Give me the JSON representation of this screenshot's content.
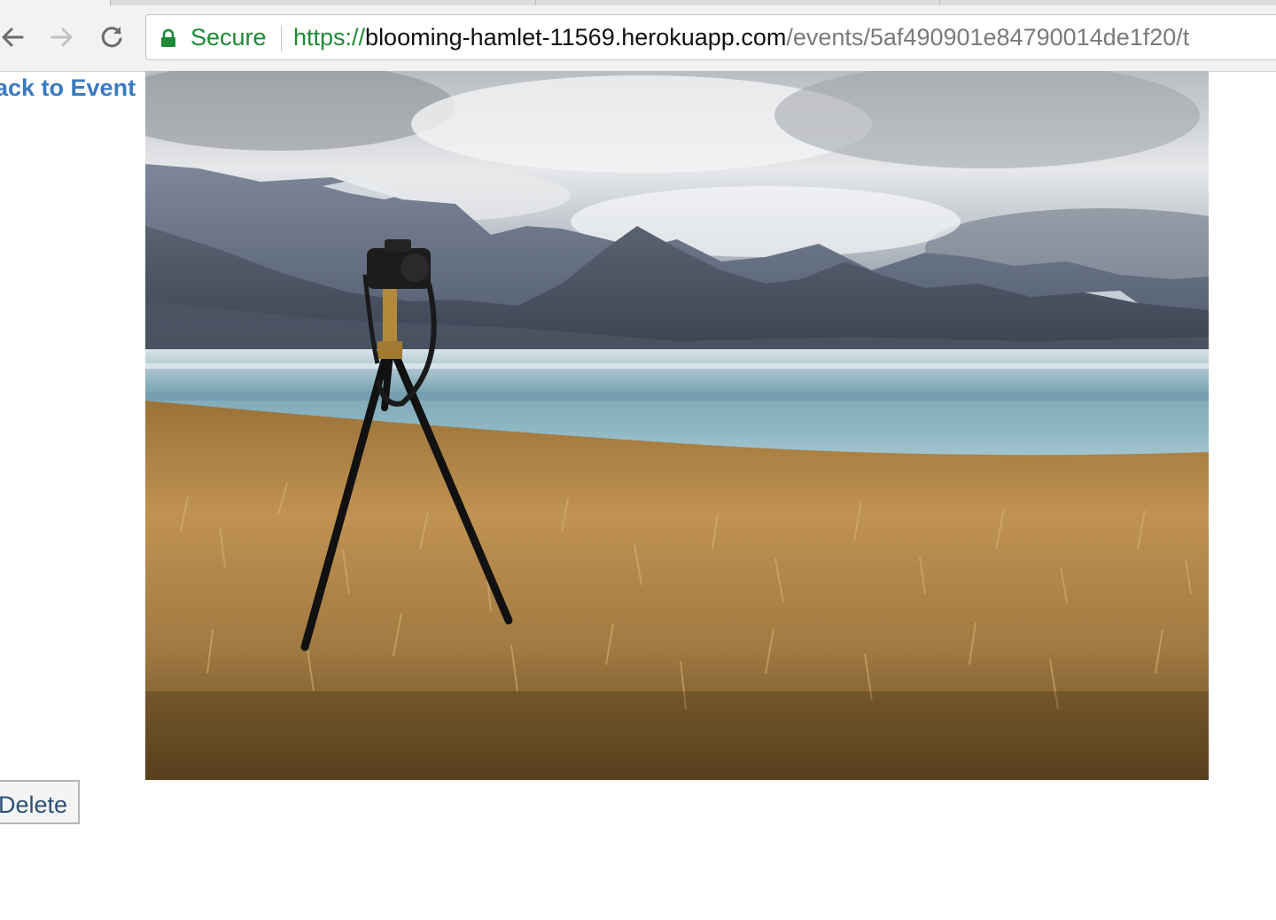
{
  "browser": {
    "secure_label": "Secure",
    "url_scheme": "https://",
    "url_host": "blooming-hamlet-11569.herokuapp.com",
    "url_path": "/events/5af490901e84790014de1f20/t",
    "icons": {
      "back": "back-arrow-icon",
      "forward": "forward-arrow-icon",
      "reload": "reload-icon",
      "lock": "lock-icon"
    },
    "colors": {
      "secure_green": "#1e8a36",
      "url_host": "#111111",
      "url_path": "#7a7a7a"
    }
  },
  "page": {
    "back_link": "ack to Event",
    "photo_alt": "",
    "delete_label": "Delete",
    "colors": {
      "link": "#3a7bbf",
      "button_text": "#2c4f74"
    }
  }
}
